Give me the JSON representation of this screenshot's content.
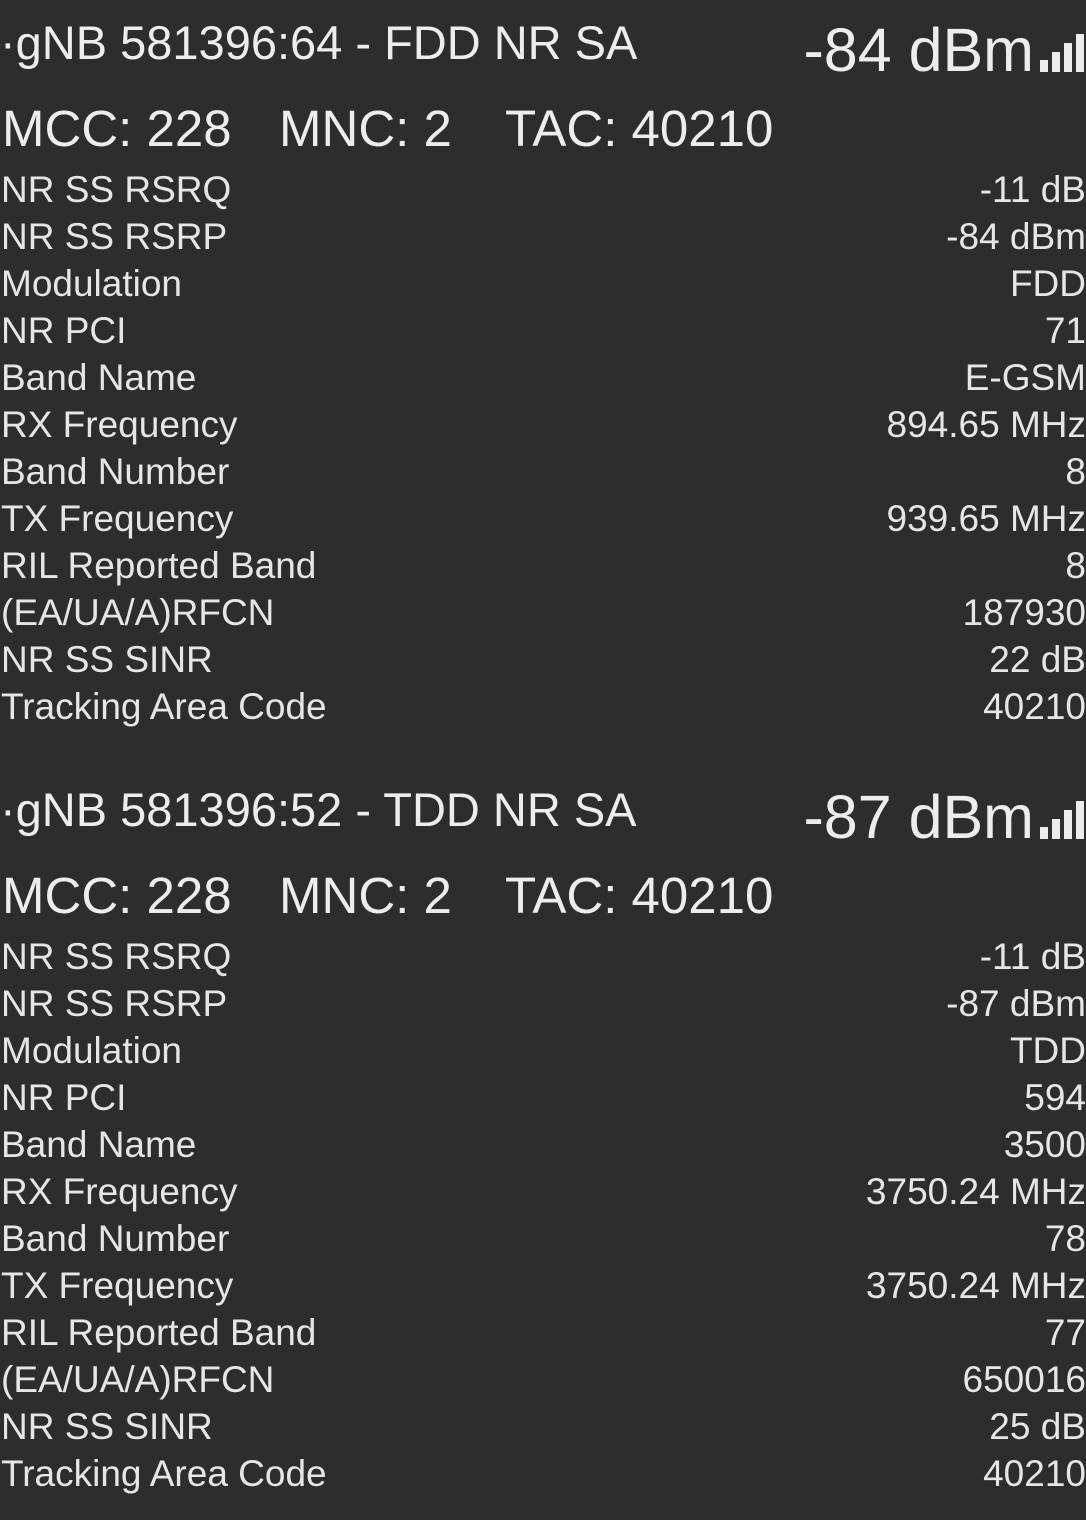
{
  "cells": [
    {
      "title": "·gNB 581396:64 - FDD NR SA",
      "signal": "-84 dBm",
      "signal_icon": "signal-bars-icon",
      "mcc": "MCC: 228",
      "mnc": "MNC: 2",
      "tac": "TAC: 40210",
      "rows": [
        {
          "label": "NR SS RSRQ",
          "value": "-11 dB"
        },
        {
          "label": "NR SS RSRP",
          "value": "-84 dBm"
        },
        {
          "label": "Modulation",
          "value": "FDD"
        },
        {
          "label": "NR PCI",
          "value": "71"
        },
        {
          "label": "Band Name",
          "value": "E-GSM"
        },
        {
          "label": "RX Frequency",
          "value": "894.65 MHz"
        },
        {
          "label": "Band Number",
          "value": "8"
        },
        {
          "label": "TX Frequency",
          "value": "939.65 MHz"
        },
        {
          "label": "RIL Reported Band",
          "value": "8"
        },
        {
          "label": "(EA/UA/A)RFCN",
          "value": "187930"
        },
        {
          "label": "NR SS SINR",
          "value": "22 dB"
        },
        {
          "label": "Tracking Area Code",
          "value": "40210"
        }
      ]
    },
    {
      "title": "·gNB 581396:52 - TDD NR SA",
      "signal": "-87 dBm",
      "signal_icon": "signal-bars-icon",
      "mcc": "MCC: 228",
      "mnc": "MNC: 2",
      "tac": "TAC: 40210",
      "rows": [
        {
          "label": "NR SS RSRQ",
          "value": "-11 dB"
        },
        {
          "label": "NR SS RSRP",
          "value": "-87 dBm"
        },
        {
          "label": "Modulation",
          "value": "TDD"
        },
        {
          "label": "NR PCI",
          "value": "594"
        },
        {
          "label": "Band Name",
          "value": "3500"
        },
        {
          "label": "RX Frequency",
          "value": "3750.24 MHz"
        },
        {
          "label": "Band Number",
          "value": "78"
        },
        {
          "label": "TX Frequency",
          "value": "3750.24 MHz"
        },
        {
          "label": "RIL Reported Band",
          "value": "77"
        },
        {
          "label": "(EA/UA/A)RFCN",
          "value": "650016"
        },
        {
          "label": "NR SS SINR",
          "value": "25 dB"
        },
        {
          "label": "Tracking Area Code",
          "value": "40210"
        }
      ]
    }
  ]
}
